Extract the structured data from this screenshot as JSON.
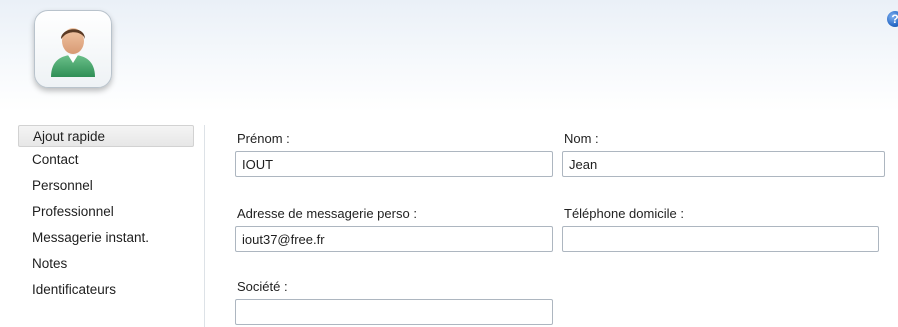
{
  "help": {
    "glyph": "?"
  },
  "sidebar": {
    "items": [
      {
        "label": "Ajout rapide",
        "active": true
      },
      {
        "label": "Contact"
      },
      {
        "label": "Personnel"
      },
      {
        "label": "Professionnel"
      },
      {
        "label": "Messagerie instant."
      },
      {
        "label": "Notes"
      },
      {
        "label": "Identificateurs"
      }
    ]
  },
  "form": {
    "first_name": {
      "label": "Prénom :",
      "value": "IOUT"
    },
    "last_name": {
      "label": "Nom :",
      "value": "Jean"
    },
    "personal_email": {
      "label": "Adresse de messagerie perso :",
      "value": "iout37@free.fr"
    },
    "home_phone": {
      "label": "Téléphone domicile :",
      "value": ""
    },
    "company": {
      "label": "Société :",
      "value": ""
    }
  },
  "colors": {
    "accent": "#2a6bc7",
    "input_border": "#adb6c0"
  }
}
